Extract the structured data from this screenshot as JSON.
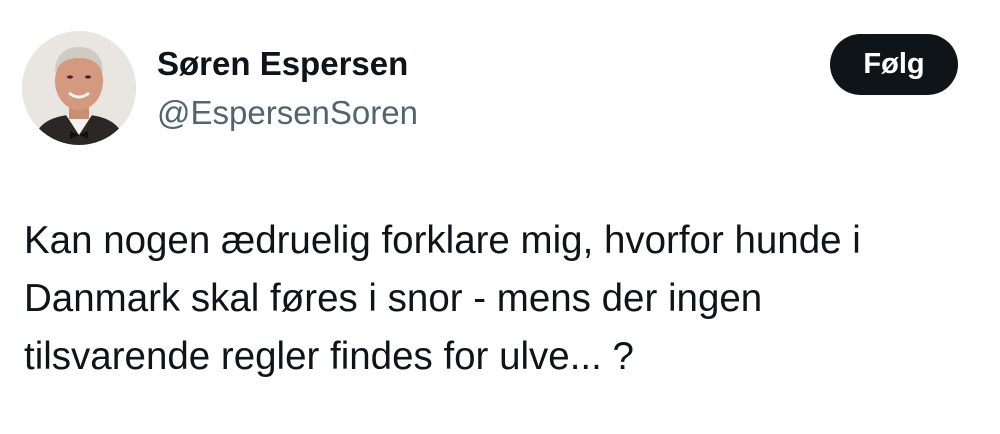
{
  "author": {
    "display_name": "Søren Espersen",
    "handle": "@EspersenSoren",
    "avatar_description": "avatar"
  },
  "follow_button": {
    "label": "Følg",
    "background_color": "#0f1419",
    "text_color": "#ffffff"
  },
  "tweet": {
    "text": "Kan nogen ædruelig forklare mig, hvorfor hunde i\nDanmark skal føres i snor - mens der ingen\ntilsvarende regler findes for ulve... ?"
  },
  "colors": {
    "text_primary": "#0f1419",
    "text_secondary": "#536471",
    "background": "#ffffff"
  }
}
